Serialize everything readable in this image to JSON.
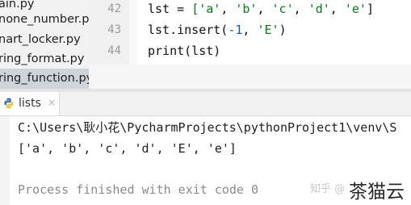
{
  "project_tree": {
    "items": [
      {
        "label": "ain.py"
      },
      {
        "label": "none_number.py"
      },
      {
        "label": "nart_locker.py"
      },
      {
        "label": "ring_format.py"
      },
      {
        "label": "ring_function.py"
      }
    ]
  },
  "editor": {
    "line_numbers": [
      "42",
      "43",
      "44"
    ],
    "lines": [
      {
        "p0": "lst = ",
        "p1": "['a'",
        "p2": ", ",
        "p3": "'b'",
        "p4": ", ",
        "p5": "'c'",
        "p6": ", ",
        "p7": "'d'",
        "p8": ", ",
        "p9": "'e'",
        "p10": "]"
      },
      {
        "p0": "lst.insert(",
        "p1": "-1",
        "p2": ", ",
        "p3": "'E'",
        "p4": ")"
      },
      {
        "p0": "print(lst)"
      }
    ]
  },
  "run": {
    "tab_label": "lists",
    "close_glyph": "×",
    "console": {
      "lines": [
        "C:\\Users\\耿小花\\PycharmProjects\\pythonProject1\\venv\\S",
        "['a', 'b', 'c', 'd', 'E', 'e']",
        "",
        "Process finished with exit code 0"
      ]
    }
  },
  "watermark": {
    "text_a": "知乎 @",
    "text_b": "茶猫云"
  },
  "colors": {
    "string": "#067d17",
    "number": "#1750eb",
    "selected_row": "#cfd3da"
  }
}
